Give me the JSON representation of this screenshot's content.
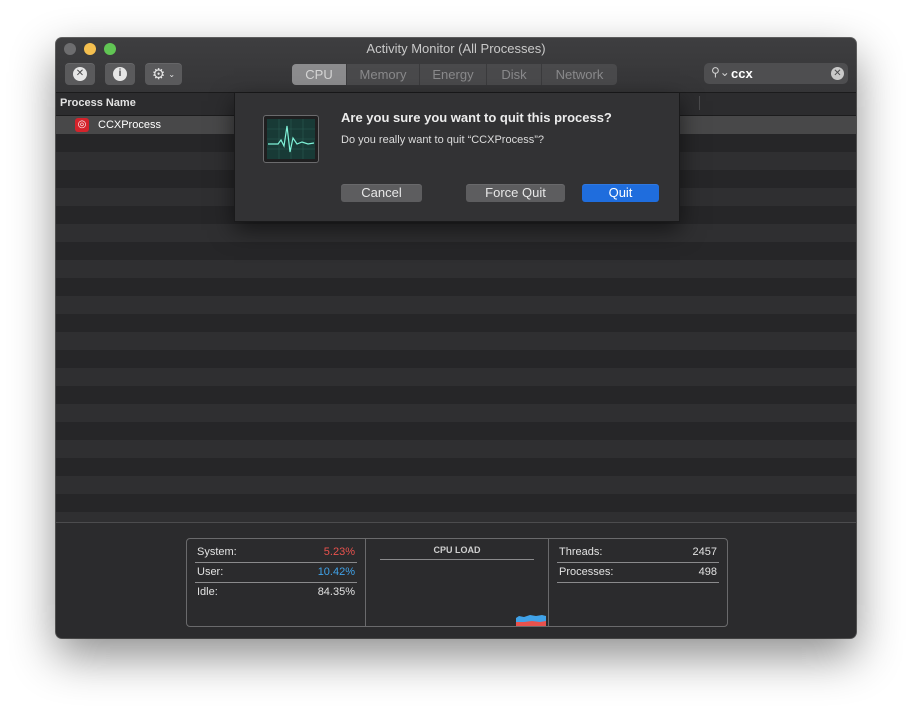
{
  "window": {
    "title": "Activity Monitor (All Processes)"
  },
  "toolbar": {
    "stop_icon_glyph": "✕",
    "info_icon_glyph": "i",
    "gear_icon_glyph": "⚙",
    "gear_chevron_glyph": "⌄"
  },
  "tabs": [
    {
      "label": "CPU",
      "active": true
    },
    {
      "label": "Memory",
      "active": false
    },
    {
      "label": "Energy",
      "active": false
    },
    {
      "label": "Disk",
      "active": false
    },
    {
      "label": "Network",
      "active": false
    }
  ],
  "search": {
    "value": "ccx",
    "icon_glyph": "⚲⌄",
    "clear_glyph": "✕"
  },
  "table": {
    "column_process_name": "Process Name",
    "rows": [
      {
        "name": "CCXProcess",
        "icon": "creative-cloud-icon",
        "icon_glyph": "◎"
      }
    ]
  },
  "dialog": {
    "title": "Are you sure you want to quit this process?",
    "message": "Do you really want to quit “CCXProcess”?",
    "cancel_label": "Cancel",
    "force_quit_label": "Force Quit",
    "quit_label": "Quit"
  },
  "stats": {
    "system_label": "System:",
    "system_value": "5.23%",
    "user_label": "User:",
    "user_value": "10.42%",
    "idle_label": "Idle:",
    "idle_value": "84.35%",
    "cpu_load_title": "CPU LOAD",
    "threads_label": "Threads:",
    "threads_value": "2457",
    "processes_label": "Processes:",
    "processes_value": "498"
  },
  "colors": {
    "accent_blue": "#1f6ddd",
    "system_red": "#e8524d",
    "user_blue": "#40a2e8",
    "traffic_close": "#6d6d6f",
    "traffic_min": "#f4bf4f",
    "traffic_max": "#61c554"
  }
}
